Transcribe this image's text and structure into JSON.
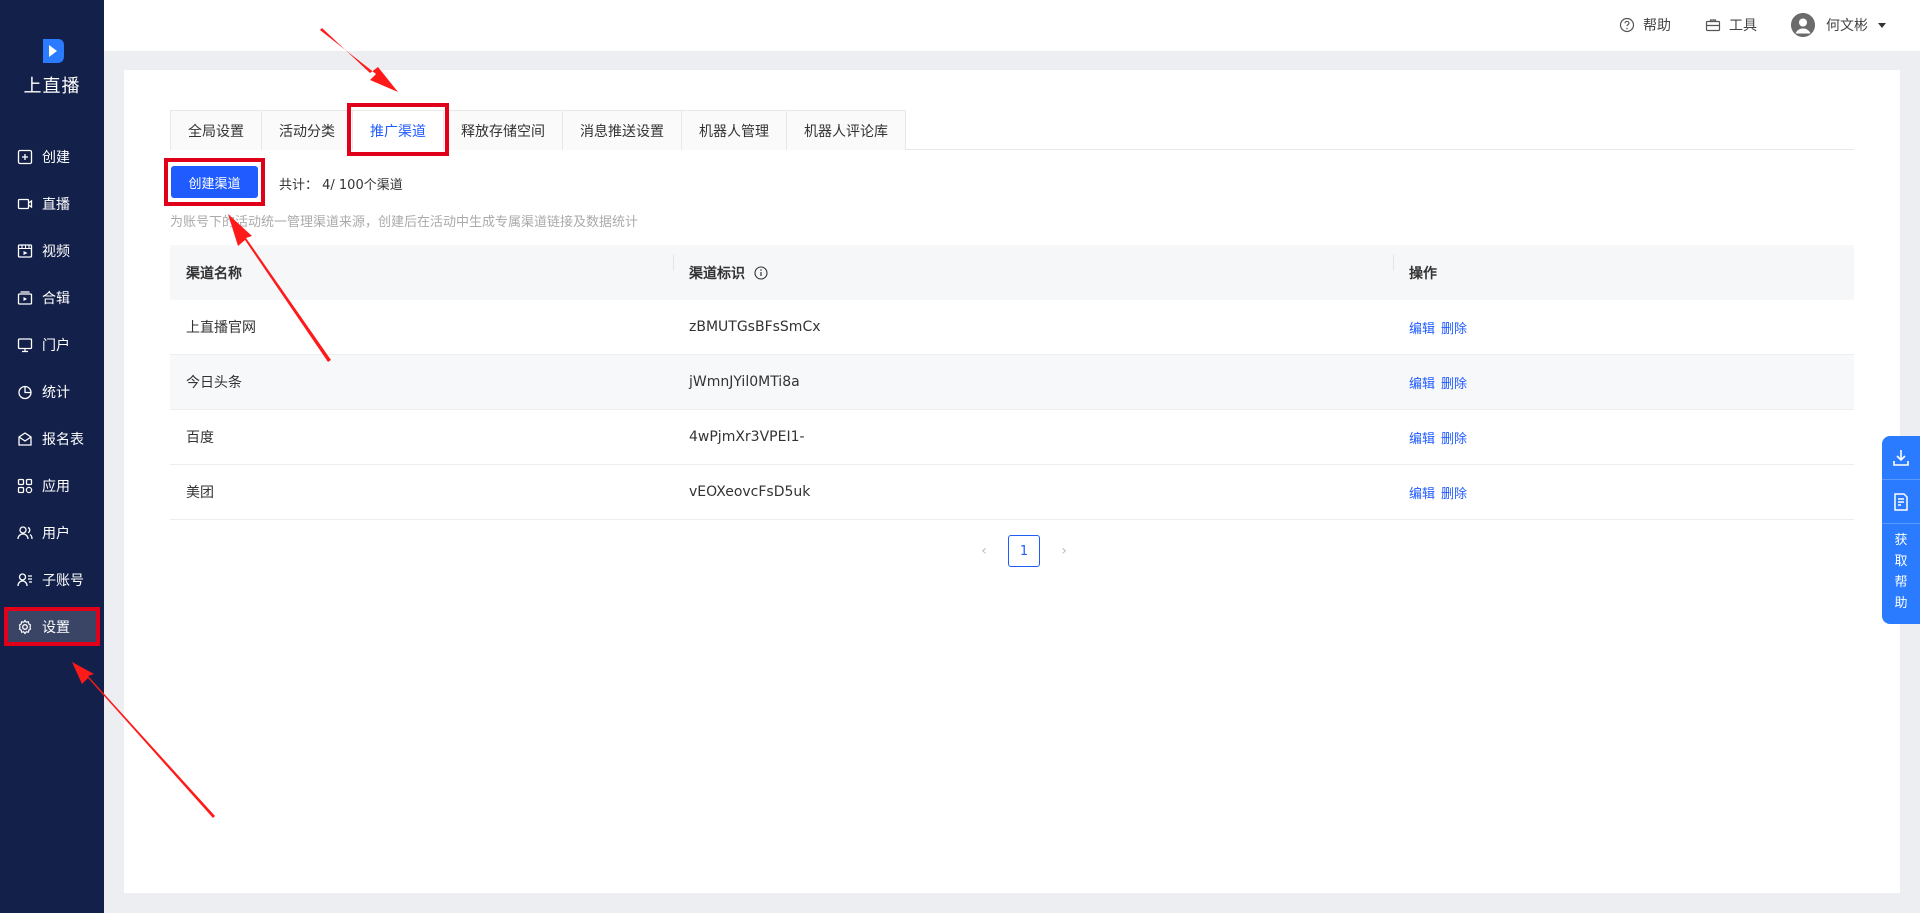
{
  "brand": {
    "name": "上直播",
    "accent": "#1f5bff",
    "sidebar_bg": "#13204a"
  },
  "sidebar": {
    "items": [
      {
        "label": "创建",
        "icon": "plus-square-icon"
      },
      {
        "label": "直播",
        "icon": "video-camera-icon"
      },
      {
        "label": "视频",
        "icon": "film-icon"
      },
      {
        "label": "合辑",
        "icon": "collection-icon"
      },
      {
        "label": "门户",
        "icon": "monitor-icon"
      },
      {
        "label": "统计",
        "icon": "pie-chart-icon"
      },
      {
        "label": "报名表",
        "icon": "form-icon"
      },
      {
        "label": "应用",
        "icon": "apps-icon"
      },
      {
        "label": "用户",
        "icon": "users-icon"
      },
      {
        "label": "子账号",
        "icon": "sub-account-icon"
      },
      {
        "label": "设置",
        "icon": "gear-icon",
        "active": true
      }
    ]
  },
  "topbar": {
    "help": "帮助",
    "tools": "工具",
    "user": "何文彬"
  },
  "tabs": [
    "全局设置",
    "活动分类",
    "推广渠道",
    "释放存储空间",
    "消息推送设置",
    "机器人管理",
    "机器人评论库"
  ],
  "active_tab": "推广渠道",
  "toolbar": {
    "create_label": "创建渠道",
    "count_text": "共计： 4/ 100个渠道"
  },
  "hint": "为账号下的活动统一管理渠道来源，创建后在活动中生成专属渠道链接及数据统计",
  "table": {
    "headers": [
      "渠道名称",
      "渠道标识",
      "操作"
    ],
    "rows": [
      {
        "name": "上直播官网",
        "id": "zBMUTGsBFsSmCx"
      },
      {
        "name": "今日头条",
        "id": "jWmnJYil0MTi8a"
      },
      {
        "name": "百度",
        "id": "4wPjmXr3VPEI1-"
      },
      {
        "name": "美团",
        "id": "vEOXeovcFsD5uk"
      }
    ],
    "actions": {
      "edit": "编辑",
      "delete": "删除"
    }
  },
  "pagination": {
    "current": "1"
  },
  "float_panel": {
    "help_text": [
      "获",
      "取",
      "帮",
      "助"
    ]
  }
}
